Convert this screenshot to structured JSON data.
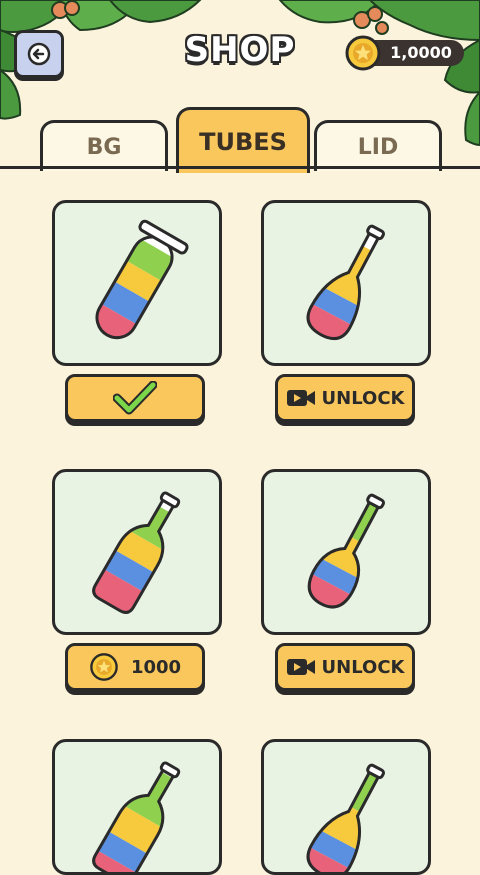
{
  "header": {
    "title": "SHOP",
    "coins": "1,0000"
  },
  "tabs": [
    {
      "label": "BG",
      "active": false
    },
    {
      "label": "TUBES",
      "active": true
    },
    {
      "label": "LID",
      "active": false
    }
  ],
  "items": [
    {
      "shape": "test-tube",
      "state": "selected",
      "icon": "check-icon"
    },
    {
      "shape": "long-neck-bottle",
      "state": "locked-video",
      "button_label": "UNLOCK",
      "icon": "video-camera-icon"
    },
    {
      "shape": "wine-bottle",
      "state": "purchasable",
      "price": "1000",
      "icon": "coin-icon"
    },
    {
      "shape": "round-flask",
      "state": "locked-video",
      "button_label": "UNLOCK",
      "icon": "video-camera-icon"
    },
    {
      "shape": "wine-bottle-green",
      "state": "partially-visible"
    },
    {
      "shape": "long-neck-bottle",
      "state": "partially-visible"
    }
  ],
  "colors": {
    "background": "#fbf3dc",
    "accent": "#f9c75c",
    "card": "#e9f3e4",
    "liquid_red": "#e8637a",
    "liquid_blue": "#5b8fe0",
    "liquid_yellow": "#f7c93c",
    "liquid_green": "#8fd14f"
  }
}
